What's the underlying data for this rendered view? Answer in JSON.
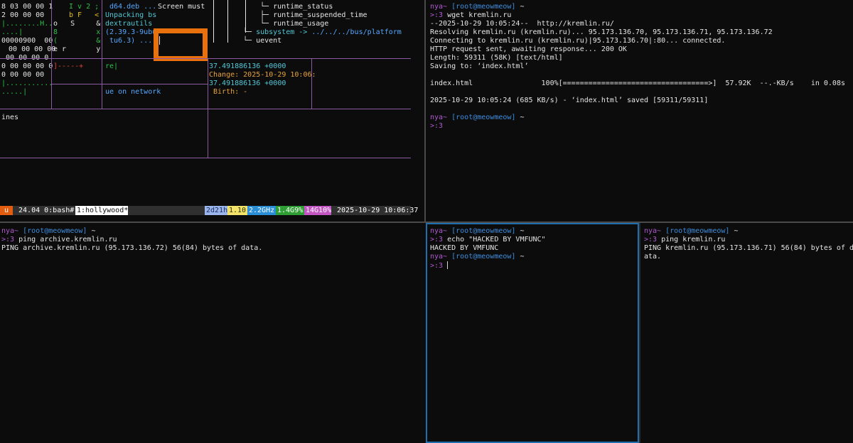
{
  "tl": {
    "hex": [
      "8 03 00 00 1",
      "2 00 00 00",
      "|........H..",
      "....|",
      "00000900  00",
      "  00 00 00 00",
      "0 00 00 00 0",
      "0 00 00 00",
      "|...........",
      ".....|"
    ],
    "col2": [
      "I v 2 ;",
      "b F   <",
      "o   S     &",
      "8         x",
      "(         &",
      "e r       y"
    ],
    "col3": [
      "d64.deb ...",
      "Unpacking bs",
      "dextrautils",
      "(2.39.3-9ubu",
      " tu6.3) ..."
    ],
    "screen_must": "Screen must",
    "tree": [
      "runtime_status",
      "runtime_suspended_time",
      "runtime_usage"
    ],
    "subsystem_label": "subsystem ->",
    "subsystem_target": "../../../bus/platform",
    "uevent": "uevent",
    "arrow": "]-----+",
    "re": "re|",
    "ue_network": "ue on network",
    "stat": [
      "37.491886136 +0000",
      "Change: 2025-10-29 10:06:",
      "37.491886136 +0000",
      " Birth: -"
    ],
    "ines": "ines"
  },
  "statusbar": {
    "session": "u",
    "left": " 24.04 0:bash#- ",
    "window": "1:hollywood*",
    "uptime": "2d21h",
    "load": "1.10",
    "cpu": "2.2GHz",
    "mem": "1.4G9%",
    "swap": "14G10%",
    "datetime": " 2025-10-29 10:06:37"
  },
  "tr": {
    "prompt_user": "nya~",
    "prompt_host": "[root@meowmeow]",
    "prompt_tilde": "~",
    "prompt_sym": ">:3",
    "cmd": "wget kremlin.ru",
    "out": [
      "--2025-10-29 10:05:24--  http://kremlin.ru/",
      "Resolving kremlin.ru (kremlin.ru)... 95.173.136.70, 95.173.136.71, 95.173.136.72",
      "Connecting to kremlin.ru (kremlin.ru)|95.173.136.70|:80... connected.",
      "HTTP request sent, awaiting response... 200 OK",
      "Length: 59311 (58K) [text/html]",
      "Saving to: ‘index.html’",
      "",
      "index.html                100%[==================================>]  57.92K  --.-KB/s    in 0.08s",
      "",
      "2025-10-29 10:05:24 (685 KB/s) - ‘index.html’ saved [59311/59311]"
    ]
  },
  "bl": {
    "cmd": "ping archive.kremlin.ru",
    "out": "PING archive.kremlin.ru (95.173.136.72) 56(84) bytes of data."
  },
  "bm": {
    "cmd": "echo \"HACKED BY VMFUNC\"",
    "out": "HACKED BY VMFUNC"
  },
  "br": {
    "cmd": "ping kremlin.ru",
    "out": [
      "PING kremlin.ru (95.173.136.71) 56(84) bytes of d",
      "ata."
    ]
  },
  "colors": {
    "highlight": "#e8710e",
    "active_border": "#1e6fb0",
    "divider": "#8c5aa0"
  }
}
